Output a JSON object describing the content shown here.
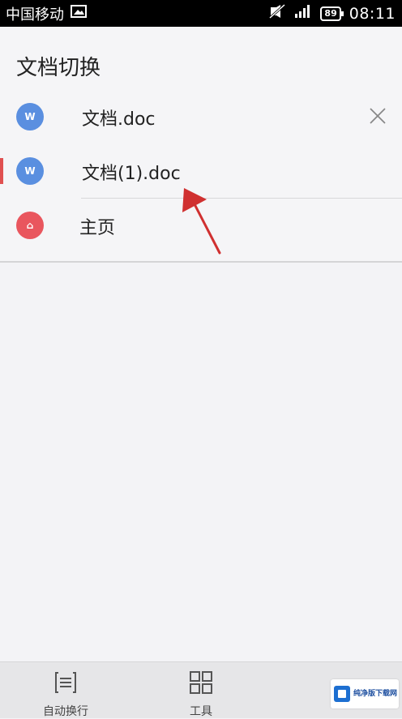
{
  "status_bar": {
    "carrier": "中国移动",
    "battery": "89",
    "time": "08:11"
  },
  "panel": {
    "title": "文档切换",
    "items": [
      {
        "label": "文档.doc",
        "icon": "W"
      },
      {
        "label": "文档(1).doc",
        "icon": "W"
      },
      {
        "label": "主页",
        "icon": "⌂"
      }
    ]
  },
  "bottom_bar": {
    "wrap_label": "自动换行",
    "tools_label": "工具"
  },
  "watermark": {
    "text": "纯净版下载网"
  },
  "colors": {
    "doc_icon": "#5a8fe0",
    "home_icon": "#e9565e",
    "active_indicator": "#e05050",
    "arrow": "#d03030"
  }
}
